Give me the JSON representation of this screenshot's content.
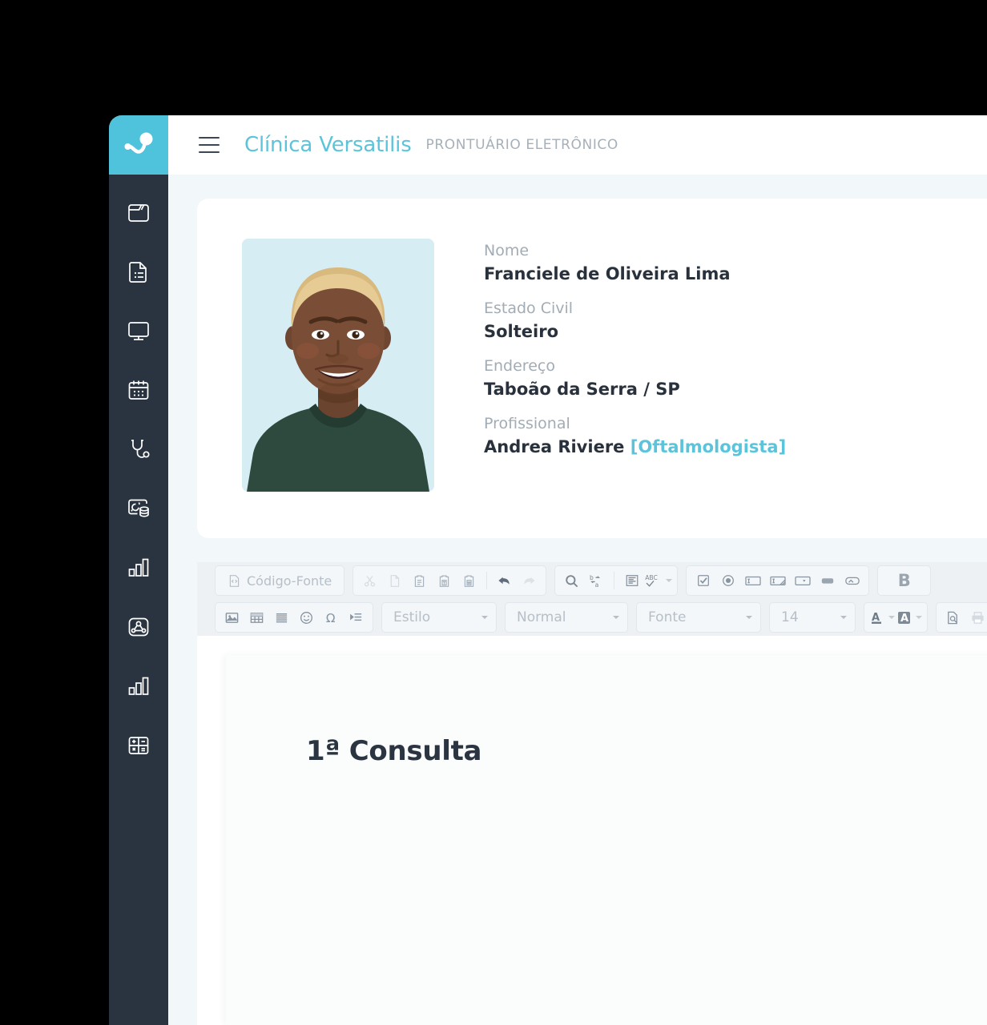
{
  "colors": {
    "accent": "#5CC4DA",
    "sidebar": "#2A3441",
    "page_bg": "#F2F7FA",
    "text_dark": "#28313C",
    "text_muted": "#A2ACB4"
  },
  "header": {
    "menu_icon": "hamburger-icon",
    "brand": "Clínica Versatilis",
    "subtitle": "PRONTUÁRIO ELETRÔNICO"
  },
  "sidebar": {
    "logo_icon": "versatilis-logo-icon",
    "items": [
      {
        "icon": "folder-icon",
        "name": "folder"
      },
      {
        "icon": "document-list-icon",
        "name": "records"
      },
      {
        "icon": "monitor-icon",
        "name": "monitor"
      },
      {
        "icon": "calendar-icon",
        "name": "calendar"
      },
      {
        "icon": "stethoscope-icon",
        "name": "clinical"
      },
      {
        "icon": "database-card-icon",
        "name": "database"
      },
      {
        "icon": "bar-chart-icon",
        "name": "reports"
      },
      {
        "icon": "network-user-icon",
        "name": "network"
      },
      {
        "icon": "bar-chart-icon",
        "name": "statistics"
      },
      {
        "icon": "calculator-icon",
        "name": "financial"
      }
    ]
  },
  "patient": {
    "photo_alt": "patient-portrait",
    "fields": [
      {
        "label": "Nome",
        "value": "Franciele de Oliveira Lima"
      },
      {
        "label": "Estado Civil",
        "value": "Solteiro"
      },
      {
        "label": "Endereço",
        "value": "Taboão da Serra / SP"
      },
      {
        "label": "Profissional",
        "value": "Andrea Riviere",
        "specialty": "[Oftalmologista]"
      }
    ]
  },
  "editor": {
    "source_button": "Código-Fonte",
    "row1_groups": [
      {
        "buttons": [
          "cut-icon",
          "copy-icon",
          "paste-icon",
          "paste-text-icon",
          "paste-word-icon",
          "divider",
          "undo-icon",
          "redo-icon"
        ]
      },
      {
        "buttons": [
          "find-icon",
          "replace-icon",
          "divider",
          "select-all-icon",
          "spellcheck-icon"
        ]
      },
      {
        "buttons": [
          "checkbox-icon",
          "radio-icon",
          "textfield-icon",
          "textarea-icon",
          "select-field-icon",
          "button-field-icon",
          "image-button-icon"
        ]
      },
      {
        "buttons": [
          "bold-icon"
        ]
      }
    ],
    "row2_groups": [
      {
        "buttons": [
          "image-icon",
          "table-icon",
          "horizontal-rule-icon",
          "smiley-icon",
          "special-char-icon",
          "page-break-icon"
        ]
      },
      {
        "buttons": [
          "text-color-icon",
          "background-color-icon"
        ]
      },
      {
        "buttons": [
          "preview-icon",
          "print-icon"
        ]
      }
    ],
    "selects": [
      {
        "name": "style-select",
        "value": "Estilo"
      },
      {
        "name": "format-select",
        "value": "Normal"
      },
      {
        "name": "font-select",
        "value": "Fonte"
      },
      {
        "name": "size-select",
        "value": "14"
      }
    ],
    "bold_label": "B"
  },
  "document": {
    "title": "1ª Consulta"
  }
}
